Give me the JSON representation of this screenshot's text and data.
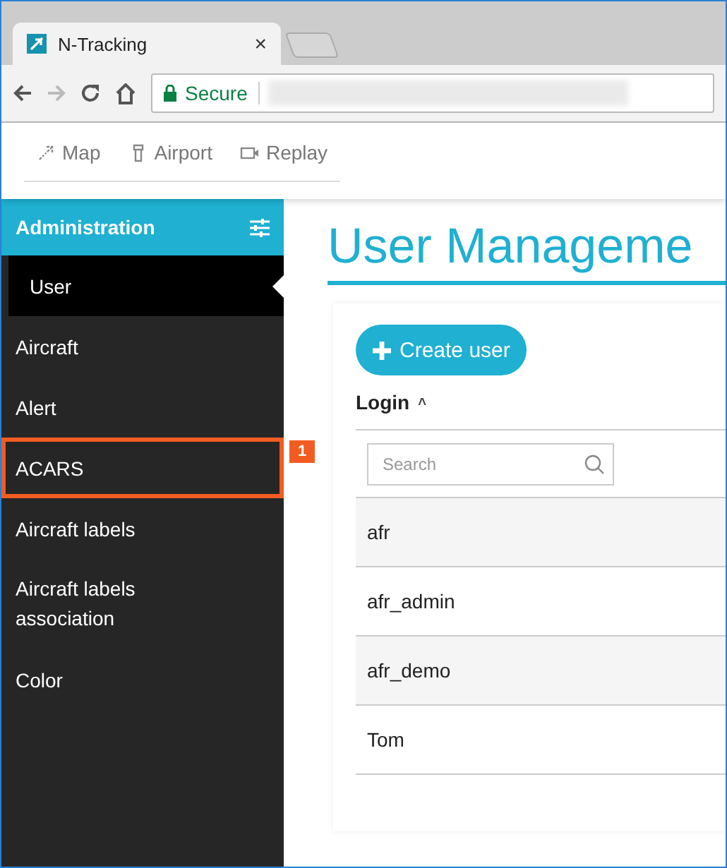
{
  "browser": {
    "tab_title": "N-Tracking",
    "tab_close": "×",
    "secure_label": "Secure"
  },
  "nav": [
    {
      "label": "Map"
    },
    {
      "label": "Airport"
    },
    {
      "label": "Replay"
    }
  ],
  "sidebar": {
    "title": "Administration",
    "items": [
      {
        "label": "User",
        "selected": true
      },
      {
        "label": "Aircraft",
        "selected": false
      },
      {
        "label": "Alert",
        "selected": false
      },
      {
        "label": "ACARS",
        "selected": false,
        "callout": "1"
      },
      {
        "label": "Aircraft labels",
        "selected": false
      },
      {
        "label": "Aircraft labels association",
        "selected": false
      },
      {
        "label": "Color",
        "selected": false
      }
    ]
  },
  "main": {
    "title": "User Manageme",
    "create_button": "Create user",
    "column": "Login",
    "sort_mark": "˄",
    "search": {
      "placeholder": "Search"
    },
    "rows": [
      {
        "login": "afr"
      },
      {
        "login": "afr_admin"
      },
      {
        "login": "afr_demo"
      },
      {
        "login": "Tom"
      }
    ]
  }
}
